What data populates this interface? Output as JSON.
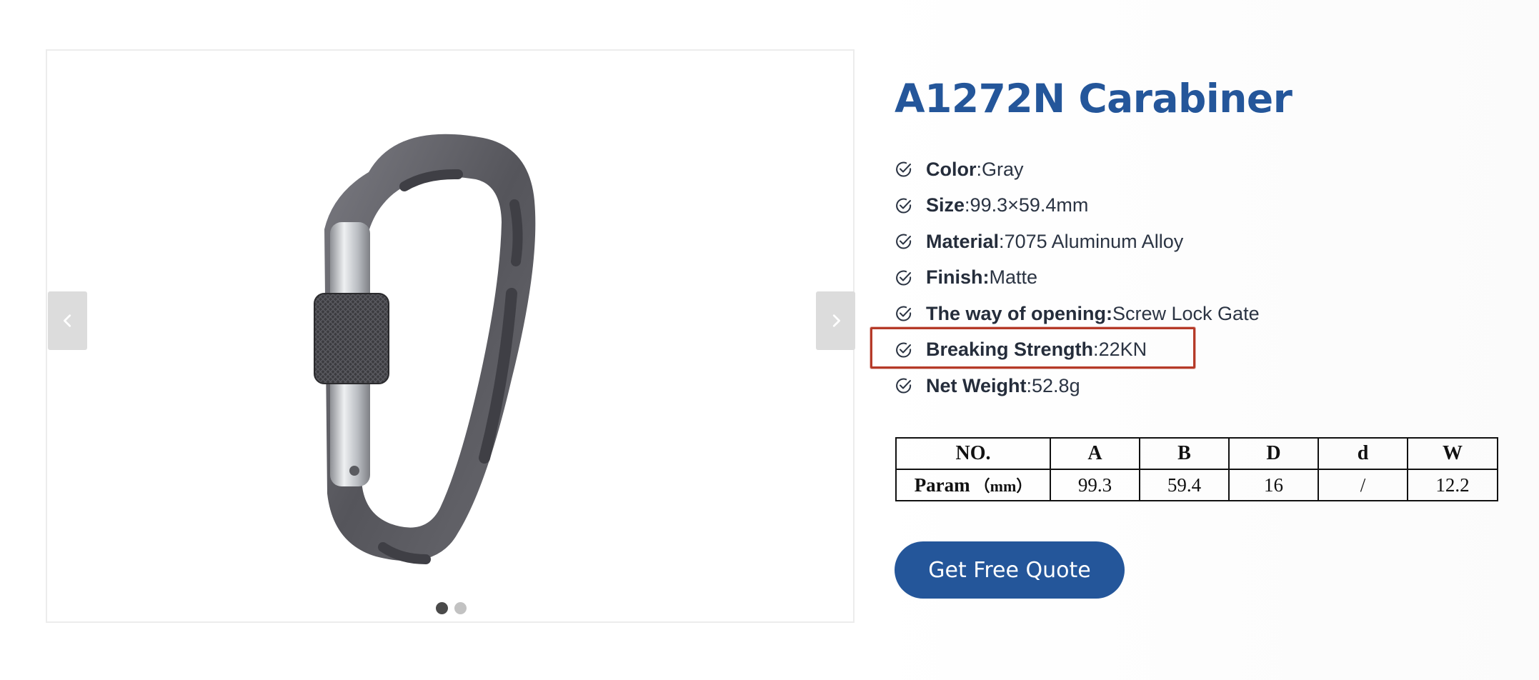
{
  "product": {
    "title": "A1272N Carabiner",
    "specs": [
      {
        "label": "Color",
        "sep": ": ",
        "value": "Gray"
      },
      {
        "label": "Size",
        "sep": ": ",
        "value": "99.3×59.4mm"
      },
      {
        "label": "Material",
        "sep": ": ",
        "value": "7075 Aluminum Alloy"
      },
      {
        "label": "Finish:",
        "sep": " ",
        "value": "Matte"
      },
      {
        "label": "The way of opening:",
        "sep": " ",
        "value": "Screw Lock Gate"
      },
      {
        "label": "Breaking Strength",
        "sep": ": ",
        "value": "22KN"
      },
      {
        "label": "Net Weight",
        "sep": ": ",
        "value": "52.8g"
      }
    ],
    "params_table": {
      "headers": [
        "NO.",
        "A",
        "B",
        "D",
        "d",
        "W"
      ],
      "row_label": "Param",
      "row_unit": "（mm）",
      "values": [
        "99.3",
        "59.4",
        "16",
        "/",
        "12.2"
      ]
    },
    "cta_label": "Get Free Quote"
  },
  "gallery": {
    "image_icon": "carabiner-photo",
    "prev_icon": "chevron-left-icon",
    "next_icon": "chevron-right-icon",
    "slide_count": 2,
    "active_slide": 1
  },
  "colors": {
    "brand": "#24569a",
    "highlight_box": "#b53a28",
    "metal": "#5f5f65",
    "nav_bg": "#dcdcdc"
  }
}
